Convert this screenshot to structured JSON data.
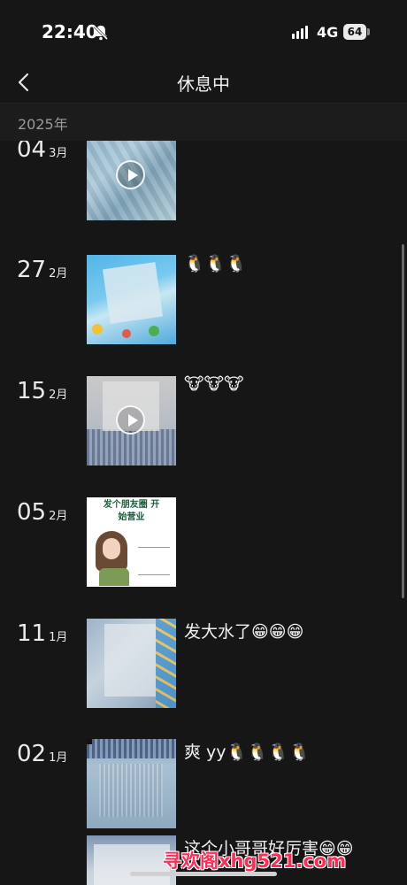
{
  "status": {
    "time": "22:40",
    "network": "4G",
    "battery": "64"
  },
  "nav": {
    "title": "休息中"
  },
  "year": "2025年",
  "posts": [
    {
      "day": "04",
      "month": "3月",
      "caption": "",
      "media": "video"
    },
    {
      "day": "27",
      "month": "2月",
      "caption": "🐧🐧🐧",
      "media": "photo"
    },
    {
      "day": "15",
      "month": "2月",
      "caption": "🐮🐮🐮",
      "media": "video"
    },
    {
      "day": "05",
      "month": "2月",
      "caption": "",
      "media": "photo",
      "image_text": "发个朋友圈 开始营业"
    },
    {
      "day": "11",
      "month": "1月",
      "caption": "发大水了😁😁😁",
      "media": "photo"
    },
    {
      "day": "02",
      "month": "1月",
      "caption": "爽 yy🐧🐧🐧🐧",
      "media": "photo"
    },
    {
      "day": "",
      "month": "",
      "caption": "这个小哥哥好厉害😁😁",
      "media": "photo"
    }
  ],
  "watermark": "寻欢阁xhg521.com",
  "colors": {
    "background": "#161616",
    "header": "#1c1c1c",
    "watermark": "#ff2d55"
  }
}
